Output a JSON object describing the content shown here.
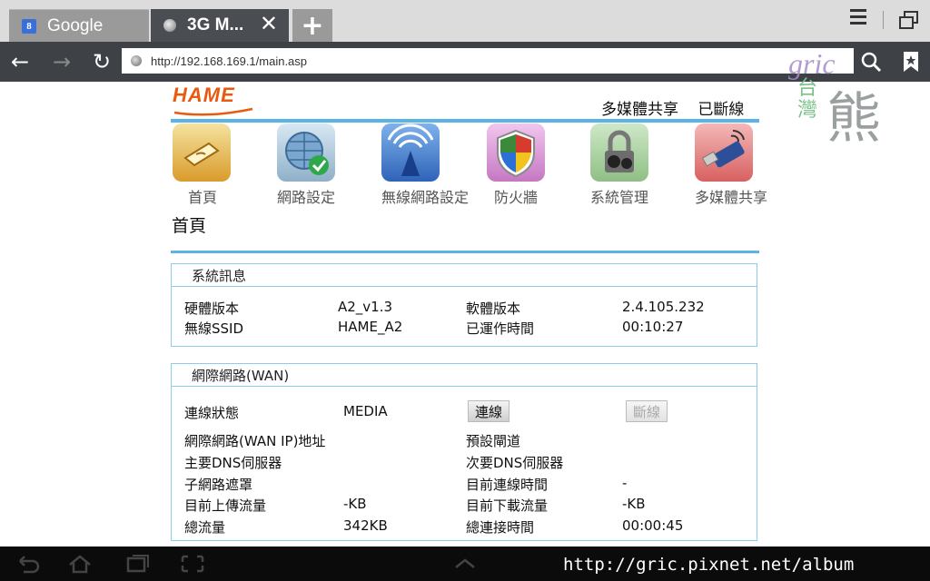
{
  "browser": {
    "tabs": [
      {
        "label": "Google"
      },
      {
        "label": "3G M..."
      }
    ],
    "new_tab": "+",
    "close_tab": "✕",
    "url": "http://192.168.169.1/main.asp"
  },
  "watermark": {
    "gric": "gric",
    "taiwan": "台灣",
    "bear": "熊"
  },
  "router": {
    "logo": "HAME",
    "top_status": {
      "media": "多媒體共享",
      "state": "已斷線"
    },
    "nav": [
      {
        "label": "首頁"
      },
      {
        "label": "網路設定"
      },
      {
        "label": "無線網路設定"
      },
      {
        "label": "防火牆"
      },
      {
        "label": "系統管理"
      },
      {
        "label": "多媒體共享"
      }
    ],
    "page_title": "首頁",
    "system_info": {
      "header": "系統訊息",
      "hw_label": "硬體版本",
      "hw_value": "A2_v1.3",
      "sw_label": "軟體版本",
      "sw_value": "2.4.105.232",
      "ssid_label": "無線SSID",
      "ssid_value": "HAME_A2",
      "uptime_label": "已運作時間",
      "uptime_value": "00:10:27"
    },
    "wan": {
      "header": "網際網路(WAN)",
      "status_label": "連線狀態",
      "status_value": "MEDIA",
      "connect_button": "連線",
      "disconnect_button": "斷線",
      "wan_ip_label": "網際網路(WAN IP)地址",
      "gateway_label": "預設閘道",
      "dns1_label": "主要DNS伺服器",
      "dns2_label": "次要DNS伺服器",
      "subnet_label": "子網路遮罩",
      "conn_time_label": "目前連線時間",
      "conn_time_value": "-",
      "upload_label": "目前上傳流量",
      "upload_value": "-KB",
      "download_label": "目前下載流量",
      "download_value": "-KB",
      "total_label": "總流量",
      "total_value": "342KB",
      "total_time_label": "總連接時間",
      "total_time_value": "00:00:45"
    }
  },
  "credit": "http://gric.pixnet.net/album"
}
